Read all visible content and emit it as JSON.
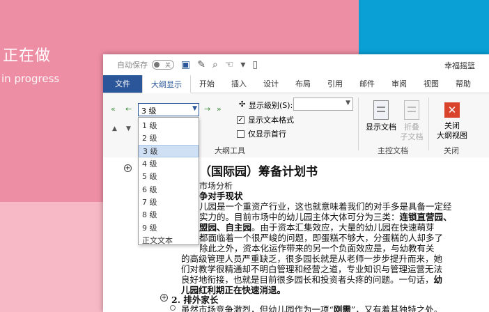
{
  "background": {
    "title": "正在做",
    "subtitle": "in progress"
  },
  "titlebar": {
    "autosave_label": "自动保存",
    "autosave_state": "关",
    "user": "幸福摇篮"
  },
  "tabs": [
    {
      "label": "文件"
    },
    {
      "label": "大纲显示"
    },
    {
      "label": "开始"
    },
    {
      "label": "插入"
    },
    {
      "label": "设计"
    },
    {
      "label": "布局"
    },
    {
      "label": "引用"
    },
    {
      "label": "邮件"
    },
    {
      "label": "审阅"
    },
    {
      "label": "视图"
    },
    {
      "label": "帮助"
    }
  ],
  "ribbon": {
    "level_value": "3 级",
    "show_level_label": "显示级别(S):",
    "show_text_format": "显示文本格式",
    "first_line_only": "仅显示首行",
    "outline_tools": "大纲工具",
    "show_document": "显示文档",
    "collapse_sub_1": "折叠",
    "collapse_sub_2": "子文档",
    "master_document": "主控文档",
    "close_1": "关闭",
    "close_2": "大纲视图",
    "close_group": "关闭"
  },
  "dropdown": {
    "items": [
      "1 级",
      "2 级",
      "3 级",
      "4 级",
      "5 级",
      "6 级",
      "7 级",
      "8 级",
      "9 级",
      "正文文本"
    ],
    "selected_index": 2
  },
  "document": {
    "title": "（国际园）筹备计划书",
    "l1": "市场分析",
    "l2": "争对手现状",
    "p1": "儿园是一个重资产行业，这也就意味着我们的对手多是具备一定经",
    "p2a": "实力的。目前市场中的幼儿园主体大体可分为三类：",
    "p2b": "连锁直营园、",
    "p3a": "盟园、自主园",
    "p3b": "。由于资本汇集效应，大量的幼儿园在快速萌芽",
    "p4": "都面临着一个很严峻的问题，即蛋糕不够大，分蛋糕的人却多了",
    "p5": "除此之外，资本化运作带来的另一个负面效应是，与幼教有关",
    "p6": "的高级管理人员严重缺乏，很多园长就是从老师一步步提升而来，她",
    "p7": "们对教学很精通却不明白管理和经营之道，专业知识与管理运营无法",
    "p8": "良好地衔接，也就是目前很多园长和投资者头疼的问题。一句话，",
    "p8b": "幼",
    "p9": "儿园红利期正在快速消退。",
    "h2": "2. 排外家长",
    "p10a": "虽然市场竞争激烈，但幼儿园作为一项“",
    "p10b": "刚需",
    "p10c": "”，又有着其独特之处。"
  }
}
